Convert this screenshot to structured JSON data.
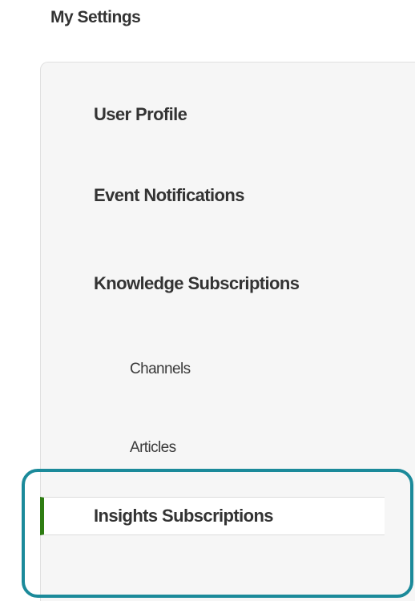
{
  "page_title": "My Settings",
  "nav": {
    "user_profile": "User Profile",
    "event_notifications": "Event Notifications",
    "knowledge_subscriptions": "Knowledge Subscriptions",
    "channels": "Channels",
    "articles": "Articles",
    "insights_subscriptions": "Insights Subscriptions"
  },
  "colors": {
    "active_indicator": "#2e7d12",
    "highlight_outline": "#1b8a9a",
    "panel_background": "#f6f6f6"
  }
}
